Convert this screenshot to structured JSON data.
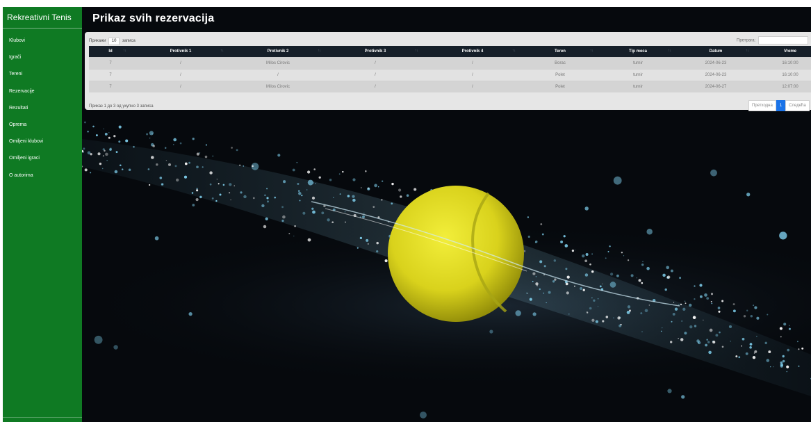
{
  "sidebar": {
    "brand": "Rekreativni Tenis",
    "items": [
      "Klubovi",
      "Igrači",
      "Tereni",
      "Rezervacije",
      "Rezultati",
      "Oprema",
      "Omiljeni klubovi",
      "Omiljeni igraci",
      "O autorima"
    ]
  },
  "page": {
    "title": "Prikaz svih rezervacija"
  },
  "table": {
    "length_label_before": "Прикажи",
    "length_value": "10",
    "length_label_after": "записа",
    "search_label": "Претрага:",
    "search_value": "",
    "columns": [
      "Id",
      "Protivnik 1",
      "Protivnik 2",
      "Protivnik 3",
      "Protivnik 4",
      "Teren",
      "Tip meca",
      "Datum",
      "Vreme"
    ],
    "sort_glyph": "↑↓",
    "rows": [
      [
        "7",
        "/",
        "Milos Cirovic",
        "/",
        "/",
        "Borac",
        "turnir",
        "2024-06-23",
        "16:10:00"
      ],
      [
        "7",
        "/",
        "/",
        "/",
        "/",
        "Polet",
        "turnir",
        "2024-06-23",
        "16:10:00"
      ],
      [
        "7",
        "/",
        "Milos Cirovic",
        "/",
        "/",
        "Polet",
        "turnir",
        "2024-06-27",
        "12:07:00"
      ]
    ],
    "info": "Приказ 1 до 3 од укупно 3 записа",
    "pager": {
      "prev": "Претходна",
      "current": "1",
      "next": "Следећа"
    }
  },
  "colors": {
    "sidebar_bg": "#0f7a23",
    "main_bg": "#06090d",
    "header_bg": "#161f29",
    "pager_active": "#1a73e8",
    "ball": "#d9d21c",
    "droplet": "#7fd0ee"
  },
  "background_art": "tennis-ball-with-water-splash"
}
